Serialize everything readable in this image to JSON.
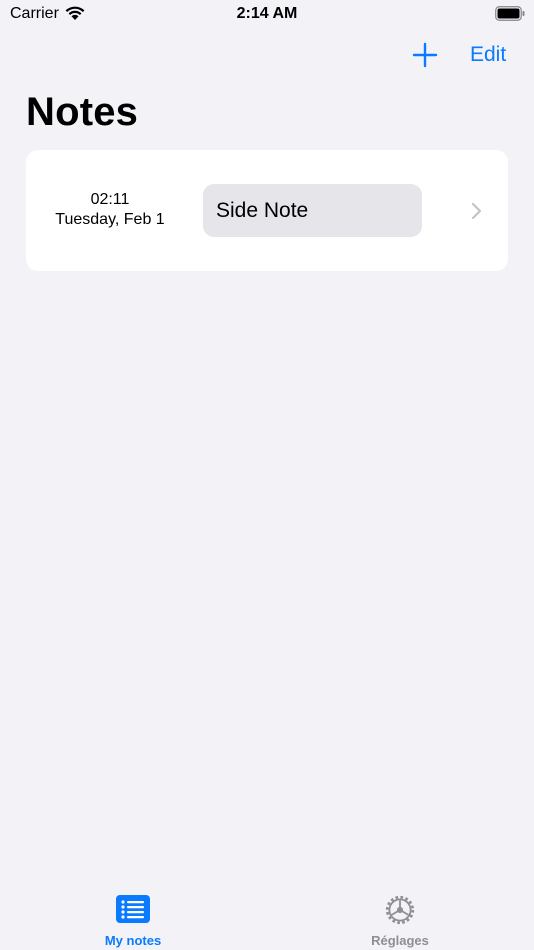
{
  "status_bar": {
    "carrier": "Carrier",
    "time": "2:14 AM"
  },
  "nav": {
    "add_icon": "plus-icon",
    "edit_label": "Edit",
    "title": "Notes"
  },
  "notes": [
    {
      "time": "02:11",
      "day": "Tuesday, Feb 1",
      "title": "Side Note"
    }
  ],
  "tab_bar": {
    "tabs": [
      {
        "label": "My notes",
        "icon": "list-icon",
        "selected": true
      },
      {
        "label": "Réglages",
        "icon": "gear-icon",
        "selected": false
      }
    ]
  },
  "colors": {
    "accent": "#0a7aff",
    "background": "#f2f2f7",
    "card": "#ffffff",
    "pill": "#e5e5ea",
    "inactive": "#8e8e93"
  }
}
